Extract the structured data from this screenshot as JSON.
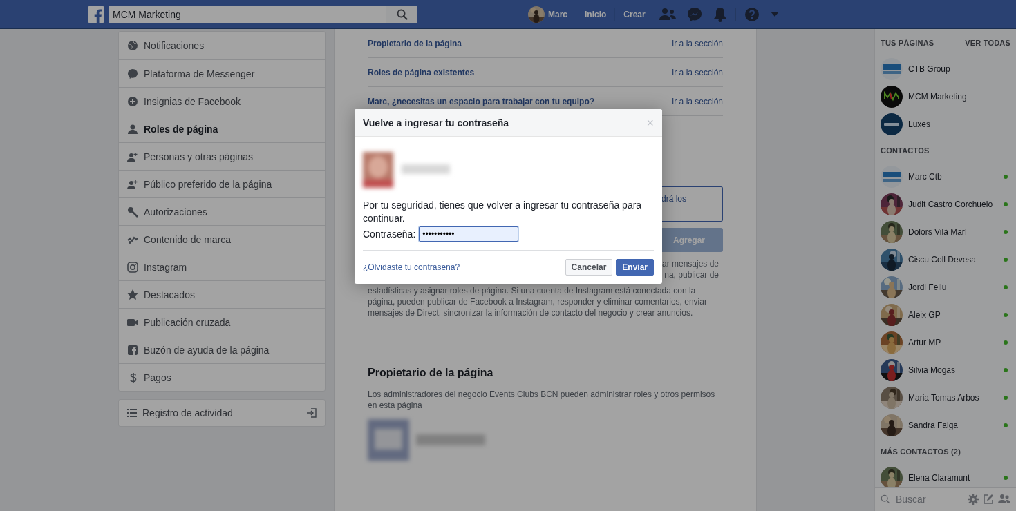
{
  "top_bar": {
    "search": {
      "value": "MCM Marketing"
    },
    "profile_name": "Marc",
    "links": [
      "Inicio",
      "Crear"
    ]
  },
  "side_nav": {
    "items": [
      {
        "label": "Notificaciones",
        "selected": false
      },
      {
        "label": "Plataforma de Messenger",
        "selected": false
      },
      {
        "label": "Insignias de Facebook",
        "selected": false
      },
      {
        "label": "Roles de página",
        "selected": true
      },
      {
        "label": "Personas y otras páginas",
        "selected": false
      },
      {
        "label": "Público preferido de la página",
        "selected": false
      },
      {
        "label": "Autorizaciones",
        "selected": false
      },
      {
        "label": "Contenido de marca",
        "selected": false
      },
      {
        "label": "Instagram",
        "selected": false
      },
      {
        "label": "Destacados",
        "selected": false
      },
      {
        "label": "Publicación cruzada",
        "selected": false
      },
      {
        "label": "Buzón de ayuda de la página",
        "selected": false
      },
      {
        "label": "Pagos",
        "selected": false
      }
    ],
    "activity_log": "Registro de actividad"
  },
  "section_links": [
    {
      "title": "Propietario de la página",
      "action": "Ir a la sección"
    },
    {
      "title": "Roles de página existentes",
      "action": "Ir a la sección"
    },
    {
      "title": "Marc, ¿necesitas un espacio para trabajar con tu equipo?",
      "action": "Ir a la sección"
    }
  ],
  "instagram_section": {
    "notice_fragment": "drá los",
    "add_button": "Agregar",
    "text_fragments": [
      "ar mensajes de",
      "na, publicar de"
    ],
    "paragraph": "estadísticas y asignar roles de página. Si una cuenta de Instagram está conectada con la página, pueden publicar de Facebook a Instagram, responder y eliminar comentarios, enviar mensajes de Direct, sincronizar la información de contacto del negocio y crear anuncios."
  },
  "owner_section": {
    "title": "Propietario de la página",
    "description": "Los administradores del negocio Events Clubs BCN pueden administrar roles y otros permisos en esta página"
  },
  "chat_sidebar": {
    "pages_heading": "TUS PÁGINAS",
    "see_all": "VER TODAS",
    "pages": [
      {
        "name": "CTB Group",
        "kind": "ctb"
      },
      {
        "name": "MCM Marketing",
        "kind": "mcm"
      },
      {
        "name": "Luxes",
        "kind": "luxes"
      }
    ],
    "contacts_heading": "CONTACTOS",
    "contacts": [
      {
        "name": "Marc Ctb",
        "online": true,
        "kind": "logo"
      },
      {
        "name": "Judit Castro Corchuelo",
        "online": true,
        "kind": "picture"
      },
      {
        "name": "Dolors Vilà Marí",
        "online": true,
        "kind": "picture"
      },
      {
        "name": "Ciscu Coll Devesa",
        "online": true,
        "kind": "picture"
      },
      {
        "name": "Jordi Feliu",
        "online": true,
        "kind": "picture"
      },
      {
        "name": "Aleix GP",
        "online": true,
        "kind": "picture"
      },
      {
        "name": "Artur MP",
        "online": true,
        "kind": "picture"
      },
      {
        "name": "Silvia Mogas",
        "online": true,
        "kind": "picture"
      },
      {
        "name": "Maria Tomas Arbos",
        "online": true,
        "kind": "picture"
      },
      {
        "name": "Sandra Falga",
        "online": true,
        "kind": "picture"
      }
    ],
    "more_heading": "MÁS CONTACTOS (2)",
    "more_contacts": [
      {
        "name": "Elena Claramunt",
        "online": true,
        "kind": "picture"
      }
    ],
    "search": {
      "placeholder": "Buscar"
    }
  },
  "dialog": {
    "title": "Vuelve a ingresar tu contraseña",
    "close": "×",
    "message": "Por tu seguridad, tienes que volver a ingresar tu contraseña para continuar.",
    "password_label": "Contraseña:",
    "password_value": "•••••••••••",
    "forgot_link": "¿Olvidaste tu contraseña?",
    "buttons": [
      {
        "label": "Cancelar",
        "kind": "secondary"
      },
      {
        "label": "Enviar",
        "kind": "primary"
      }
    ]
  }
}
